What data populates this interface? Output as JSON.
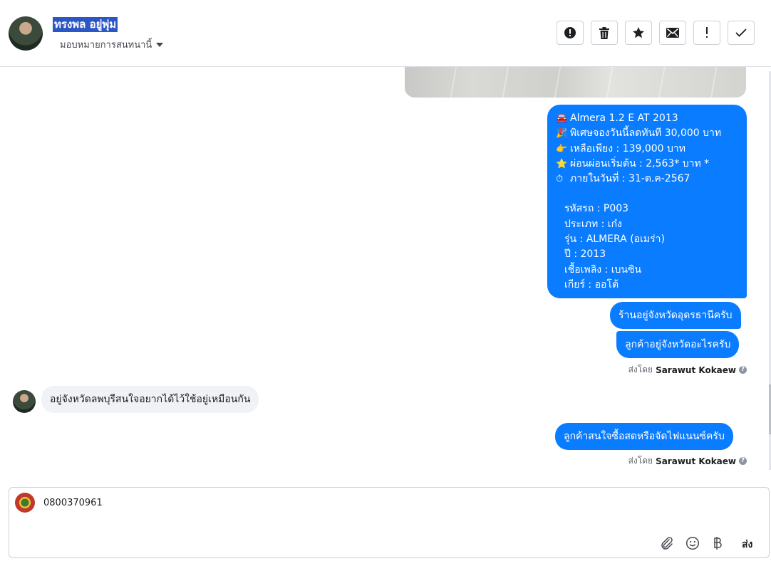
{
  "header": {
    "contact_name": "ทรงพล อยู่พุ่ม",
    "assign_label": "มอบหมายการสนทนานี้",
    "toolbar_icons": [
      "alert-circle-icon",
      "trash-icon",
      "star-icon",
      "mail-icon",
      "exclamation-icon",
      "check-icon"
    ]
  },
  "card": {
    "lines": [
      {
        "emoji": "🚘",
        "text": "Almera 1.2 E AT 2013"
      },
      {
        "emoji": "🎉",
        "text": "พิเศษจองวันนี้ลดทันที 30,000 บาท"
      },
      {
        "emoji": "👉",
        "text": "เหลือเพียง : 139,000 บาท"
      },
      {
        "emoji": "⭐",
        "text": "ผ่อนผ่อนเริ่มต้น : 2,563* บาท *"
      },
      {
        "emoji": "⏱",
        "text": "ภายในวันที่ : 31-ต.ค-2567"
      }
    ],
    "details": [
      "รหัสรถ : P003",
      "ประเภท : เก๋ง",
      "รุ่น : ALMERA (อเมร่า)",
      "ปี : 2013",
      "เชื้อเพลิง : เบนซิน",
      "เกียร์ : ออโต้"
    ]
  },
  "messages": {
    "out1": "ร้านอยู่จังหวัดอุดรธานีครับ",
    "out2": "ลูกค้าอยู่จังหวัดอะไรครับ",
    "sent_by_label": "ส่งโดย",
    "sent_by_name": "Sarawut Kokaew",
    "in1": "อยู่จังหวัดลพบุรีสนใจอยากได้ไว้ใช้อยู่เหมือนกัน",
    "out3": "ลูกค้าสนใจซื้อสดหรือจัดไฟแนนซ์ครับ"
  },
  "composer": {
    "value": "0800370961",
    "send_label": "ส่ง",
    "icons": [
      "paperclip-icon",
      "smiley-icon",
      "baht-icon"
    ]
  },
  "colors": {
    "outgoing_bubble": "#0a7cff",
    "incoming_bubble": "#f0f2f5",
    "name_highlight": "#2a56c6"
  }
}
